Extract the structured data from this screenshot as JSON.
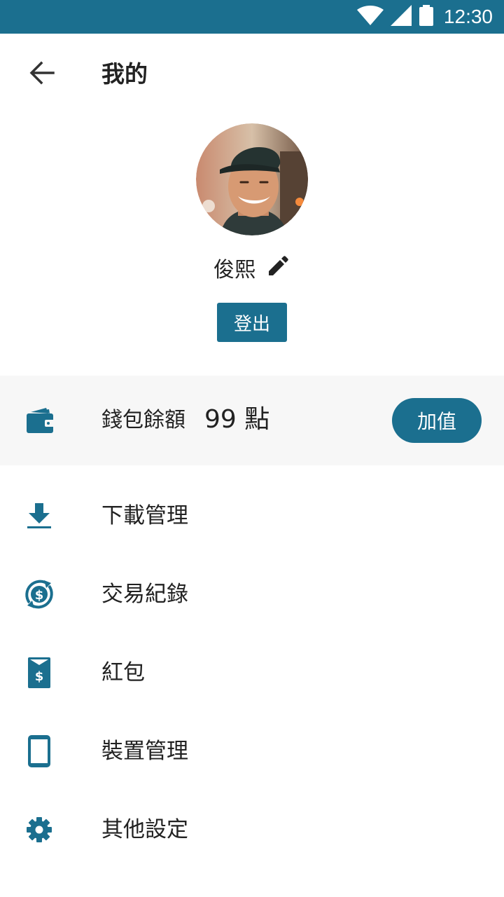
{
  "status_bar": {
    "time": "12:30",
    "icons": [
      "wifi-icon",
      "signal-icon",
      "battery-icon"
    ],
    "background_color": "#1b6f8f"
  },
  "app_bar": {
    "title": "我的",
    "back_icon": "arrow-left-icon"
  },
  "profile": {
    "name": "俊熙",
    "edit_icon": "pencil-icon",
    "logout_label": "登出"
  },
  "wallet": {
    "label": "錢包餘額",
    "points": "99 點",
    "topup_label": "加值",
    "icon": "wallet-icon"
  },
  "menu": {
    "items": [
      {
        "label": "下載管理",
        "icon": "download-icon"
      },
      {
        "label": "交易紀錄",
        "icon": "dollar-history-icon"
      },
      {
        "label": "紅包",
        "icon": "red-envelope-icon"
      },
      {
        "label": "裝置管理",
        "icon": "phone-icon"
      },
      {
        "label": "其他設定",
        "icon": "gear-icon"
      }
    ]
  },
  "colors": {
    "accent": "#1b6f8f",
    "wallet_background": "#f7f7f7",
    "text": "#222222"
  }
}
